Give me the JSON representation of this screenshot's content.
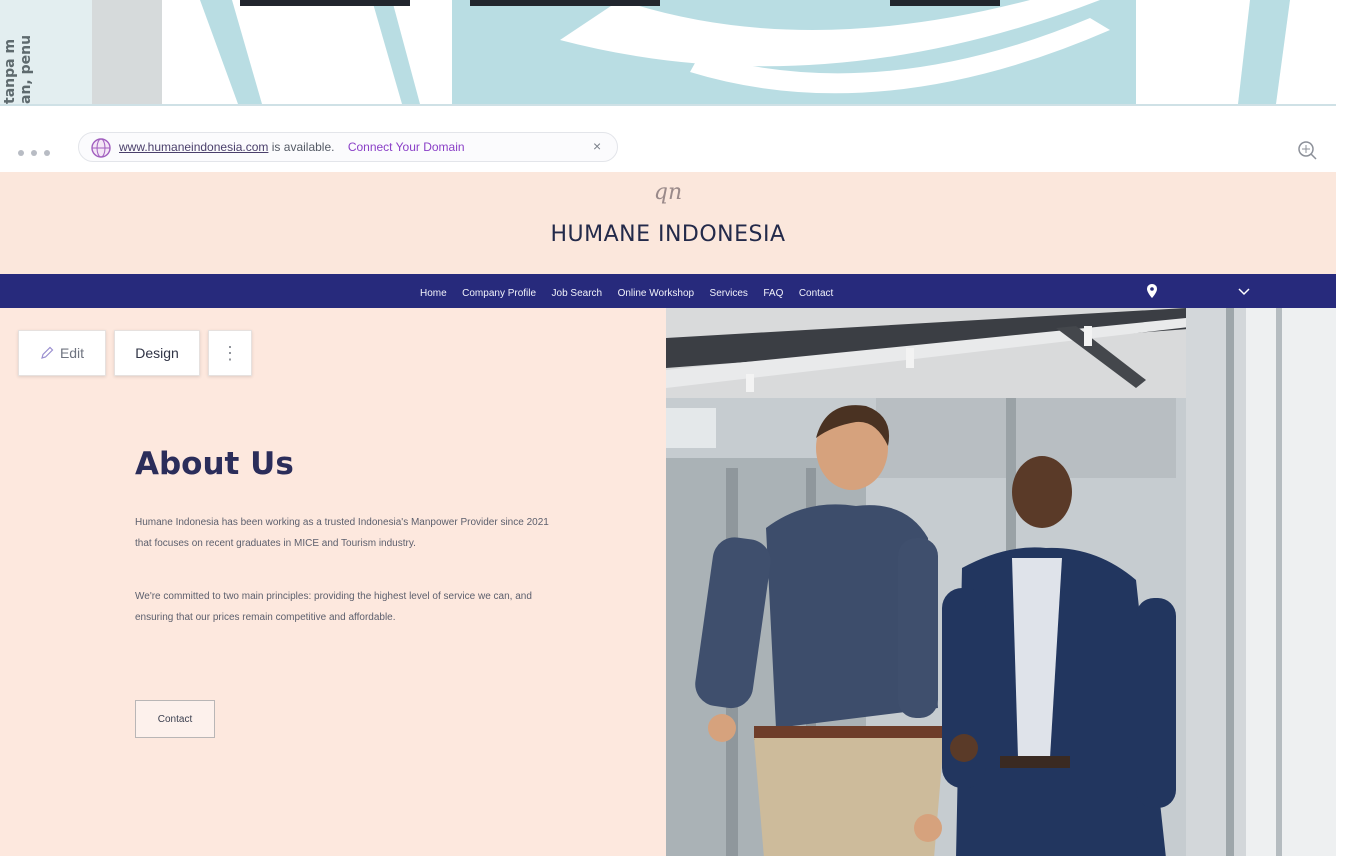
{
  "background": {
    "vertical_text_lines": [
      "tanpa m",
      "an, penu"
    ]
  },
  "browser": {
    "url_domain": "www.humaneindonesia.com",
    "url_status": "is available.",
    "url_connect": "Connect Your Domain",
    "url_close": "×"
  },
  "site": {
    "logo": "qn",
    "title": "HUMANE INDONESIA",
    "nav": [
      "Home",
      "Company Profile",
      "Job Search",
      "Online Workshop",
      "Services",
      "FAQ",
      "Contact"
    ]
  },
  "editor": {
    "edit_label": "Edit",
    "design_label": "Design",
    "more_label": "⋮"
  },
  "about": {
    "title": "About Us",
    "paragraph1": "Humane Indonesia has been working as a trusted Indonesia's Manpower Provider since 2021 that focuses on recent graduates in MICE and Tourism industry.",
    "paragraph2": "We're committed to two main principles: providing the highest level of service we can, and ensuring that our prices remain competitive and affordable.",
    "contact_label": "Contact"
  },
  "photo": {
    "description_icon": "photo-two-businessmen"
  },
  "colors": {
    "nav_bg": "#272a7c",
    "header_bg": "#fbe7dc",
    "title": "#232a4a",
    "accent_teal": "#b9dde3"
  }
}
